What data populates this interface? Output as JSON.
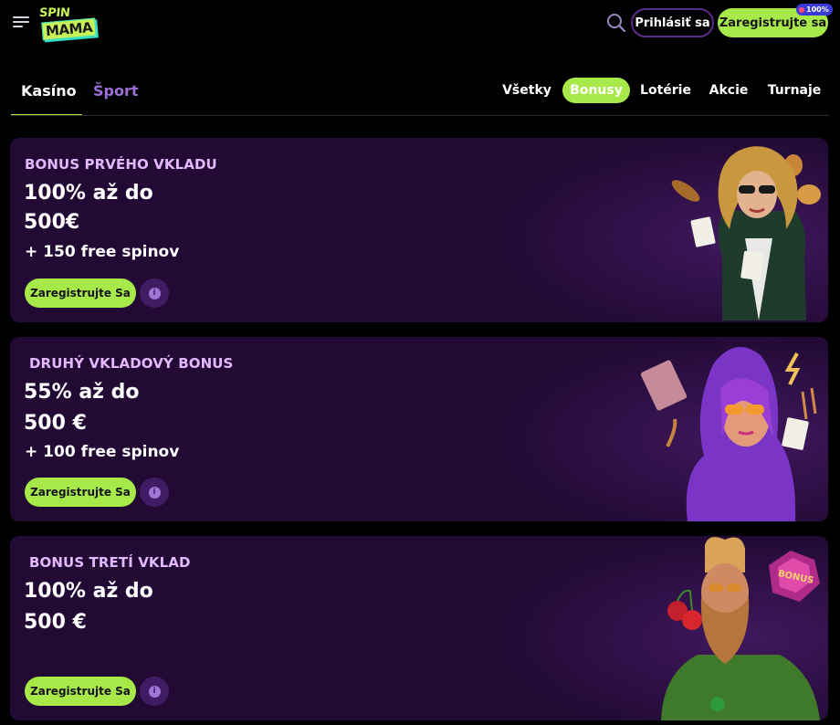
{
  "header": {
    "logo_top": "SPIN",
    "logo_bottom": "MAMA",
    "login_label": "Prihlásiť sa",
    "register_label": "Zaregistrujte sa",
    "badge_text": "100%"
  },
  "tabs": {
    "main": [
      "Kasíno",
      "Šport"
    ],
    "filters": [
      "Všetky",
      "Bonusy",
      "Lotérie",
      "Akcie",
      "Turnaje"
    ],
    "active_filter": "Bonusy"
  },
  "cards": [
    {
      "kicker": "BONUS PRVÉHO VKLADU",
      "line1": "100% až do",
      "line2": "500€",
      "sub": "+ 150 free spinov",
      "button": "Zaregistrujte Sa",
      "art": "woman-in-suit-with-cards-and-coins"
    },
    {
      "kicker": "DRUHÝ VKLADOVÝ BONUS",
      "line1": "55% až do",
      "line2": "500 €",
      "sub": "+ 100 free spinov",
      "button": "Zaregistrujte Sa",
      "art": "woman-in-hood-with-card-and-music-notes"
    },
    {
      "kicker": "BONUS TRETÍ VKLAD",
      "line1": "100% až do",
      "line2": "500 €",
      "sub": "",
      "button": "Zaregistrujte Sa",
      "art": "bearded-man-with-cherries-and-bonus-gem",
      "art_label": "BONUS"
    }
  ],
  "colors": {
    "accent": "#a8e94a",
    "card_bg": "#220a35",
    "kicker": "#e4b8ff",
    "sport_tab": "#9b6fd6"
  }
}
